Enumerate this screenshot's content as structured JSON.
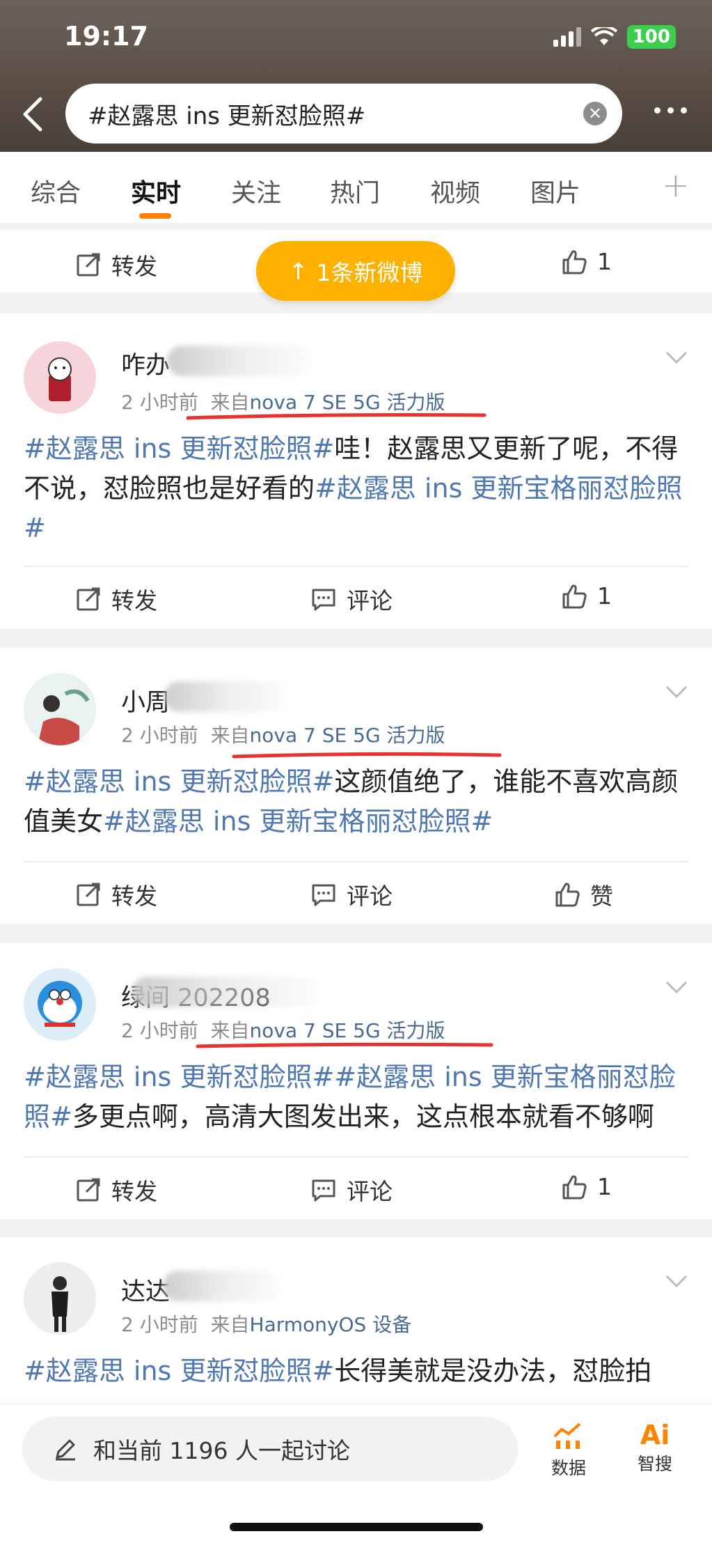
{
  "status": {
    "time": "19:17",
    "battery": "100"
  },
  "search": {
    "query": "#赵露思 ins 更新怼脸照#"
  },
  "tabs": [
    {
      "label": "综合"
    },
    {
      "label": "实时"
    },
    {
      "label": "关注"
    },
    {
      "label": "热门"
    },
    {
      "label": "视频"
    },
    {
      "label": "图片"
    }
  ],
  "new_weibo_pill": {
    "label": "1条新微博"
  },
  "top_actions": {
    "repost": "转发",
    "like_count": "1"
  },
  "posts": [
    {
      "username": "咋办",
      "time": "2 小时前",
      "from": "来自",
      "source": "nova 7 SE 5G 活力版",
      "text": [
        {
          "t": "#赵露思 ins 更新怼脸照#",
          "tag": true
        },
        {
          "t": "哇！赵露思又更新了呢，不得不说，怼脸照也是好看的",
          "tag": false
        },
        {
          "t": "#赵露思 ins 更新宝格丽怼脸照#",
          "tag": true
        }
      ],
      "actions": {
        "repost": "转发",
        "comment": "评论",
        "like": "1"
      }
    },
    {
      "username": "小周",
      "time": "2 小时前",
      "from": "来自",
      "source": "nova 7 SE 5G 活力版",
      "text": [
        {
          "t": "#赵露思 ins 更新怼脸照#",
          "tag": true
        },
        {
          "t": "这颜值绝了，谁能不喜欢高颜值美女",
          "tag": false
        },
        {
          "t": "#赵露思 ins 更新宝格丽怼脸照#",
          "tag": true
        }
      ],
      "actions": {
        "repost": "转发",
        "comment": "评论",
        "like": "赞"
      }
    },
    {
      "username": "绿间 202208",
      "time": "2 小时前",
      "from": "来自",
      "source": "nova 7 SE 5G 活力版",
      "text": [
        {
          "t": "#赵露思 ins 更新怼脸照##赵露思 ins 更新宝格丽怼脸照#",
          "tag": true
        },
        {
          "t": "多更点啊，高清大图发出来，这点根本就看不够啊",
          "tag": false
        }
      ],
      "actions": {
        "repost": "转发",
        "comment": "评论",
        "like": "1"
      }
    },
    {
      "username": "达达",
      "time": "2 小时前",
      "from": "来自",
      "source": "HarmonyOS 设备",
      "text": [
        {
          "t": "#赵露思 ins 更新怼脸照#",
          "tag": true
        },
        {
          "t": "长得美就是没办法，怼脸拍",
          "tag": false
        }
      ]
    }
  ],
  "bottom_bar": {
    "compose_placeholder": "和当前 1196 人一起讨论",
    "data_label": "数据",
    "ai_label": "智搜"
  },
  "colors": {
    "accent": "#ff8200",
    "pill": "#ffb100",
    "link": "#4e77b3",
    "annotation": "#e8322f"
  }
}
